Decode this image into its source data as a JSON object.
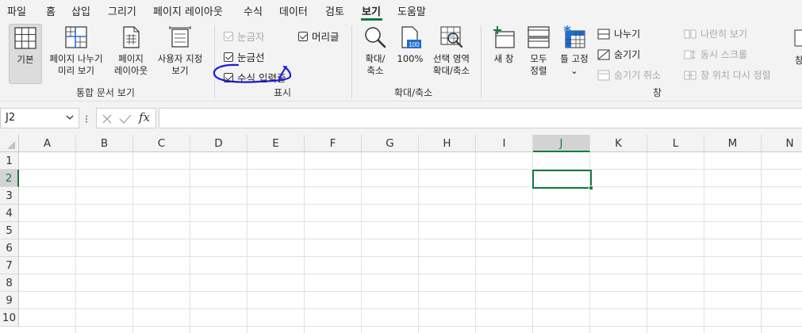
{
  "menu": {
    "tabs": [
      "파일",
      "홈",
      "삽입",
      "그리기",
      "페이지 레이아웃",
      "수식",
      "데이터",
      "검토",
      "보기",
      "도움말"
    ],
    "active_tab": "보기"
  },
  "ribbon": {
    "workbook_views": {
      "normal": "기본",
      "page_break_1": "페이지 나누기",
      "page_break_2": "미리 보기",
      "page_layout_1": "페이지",
      "page_layout_2": "레이아웃",
      "custom_1": "사용자 지정",
      "custom_2": "보기",
      "group_label": "통합 문서 보기"
    },
    "show": {
      "ruler": "눈금자",
      "gridlines": "눈금선",
      "formula_bar": "수식 입력줄",
      "headings": "머리글",
      "group_label": "표시"
    },
    "zoom": {
      "zoom_1": "확대/",
      "zoom_2": "축소",
      "zoom100": "100%",
      "zoom_sel_1": "선택 영역",
      "zoom_sel_2": "확대/축소",
      "group_label": "확대/축소",
      "icon_text": "100"
    },
    "window": {
      "new_window": "새 창",
      "arrange_1": "모두",
      "arrange_2": "정렬",
      "freeze": "틀 고정",
      "freeze_caret": "⌄",
      "split": "나누기",
      "hide": "숨기기",
      "unhide": "숨기기 취소",
      "side_by_side": "나란히 보기",
      "sync_scroll": "동시 스크롤",
      "reset_position": "창 위치 다시 정렬",
      "switch_partial": "창",
      "group_label": "창"
    }
  },
  "formula_bar": {
    "name_box": "J2",
    "fx": "fx",
    "content": ""
  },
  "sheet": {
    "columns": [
      "A",
      "B",
      "C",
      "D",
      "E",
      "F",
      "G",
      "H",
      "I",
      "J",
      "K",
      "L",
      "M",
      "N"
    ],
    "rows": [
      "1",
      "2",
      "3",
      "4",
      "5",
      "6",
      "7",
      "8",
      "9",
      "10"
    ],
    "active_column": "J",
    "active_row": "2"
  },
  "colors": {
    "accent": "#107c41",
    "annotation": "#1a1ad6"
  }
}
